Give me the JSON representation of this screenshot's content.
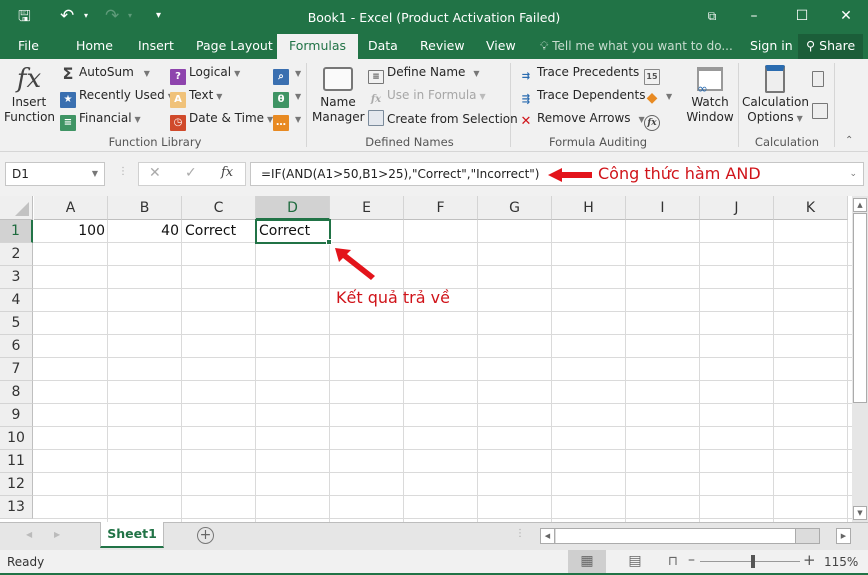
{
  "window": {
    "title": "Book1 - Excel (Product Activation Failed)",
    "controls": {
      "ribbon_display": "⧉",
      "minimize": "–",
      "maximize": "☐",
      "close": "✕"
    }
  },
  "qat": {
    "save": "🖫",
    "undo": "↶",
    "redo": "↷",
    "customize": "▾"
  },
  "tabs": [
    {
      "label": "File"
    },
    {
      "label": "Home"
    },
    {
      "label": "Insert"
    },
    {
      "label": "Page Layout"
    },
    {
      "label": "Formulas",
      "active": true
    },
    {
      "label": "Data"
    },
    {
      "label": "Review"
    },
    {
      "label": "View"
    }
  ],
  "tellme": {
    "placeholder": "Tell me what you want to do..."
  },
  "account": {
    "signin": "Sign in",
    "share": "Share"
  },
  "ribbon": {
    "function_library": {
      "label": "Function Library",
      "insert_function": [
        "Insert",
        "Function"
      ],
      "autosum": "AutoSum",
      "recently_used": "Recently Used",
      "financial": "Financial",
      "logical": "Logical",
      "text": "Text",
      "date_time": "Date & Time"
    },
    "defined_names": {
      "label": "Defined Names",
      "name_manager": [
        "Name",
        "Manager"
      ],
      "define_name": "Define Name",
      "use_in_formula": "Use in Formula",
      "create_from_selection": "Create from Selection"
    },
    "formula_auditing": {
      "label": "Formula Auditing",
      "trace_precedents": "Trace Precedents",
      "trace_dependents": "Trace Dependents",
      "remove_arrows": "Remove Arrows",
      "watch_window": [
        "Watch",
        "Window"
      ]
    },
    "calculation": {
      "label": "Calculation",
      "calc_options": [
        "Calculation",
        "Options"
      ]
    }
  },
  "formula_bar": {
    "name_box": "D1",
    "cancel": "✕",
    "enter": "✓",
    "fx": "fx",
    "formula": "=IF(AND(A1>50,B1>25),\"Correct\",\"Incorrect\")"
  },
  "annotations": {
    "formula_note": "Công thức hàm AND",
    "result_note": "Kết quả trả về",
    "color": "#d0141a"
  },
  "grid": {
    "columns": [
      "A",
      "B",
      "C",
      "D",
      "E",
      "F",
      "G",
      "H",
      "I",
      "J",
      "K"
    ],
    "rows": [
      "1",
      "2",
      "3",
      "4",
      "5",
      "6",
      "7",
      "8",
      "9",
      "10",
      "11",
      "12",
      "13"
    ],
    "selected_cell": "D1",
    "cells": {
      "A1": "100",
      "B1": "40",
      "C1": "Correct",
      "D1": "Correct"
    }
  },
  "sheets": [
    {
      "label": "Sheet1",
      "active": true
    }
  ],
  "status": {
    "ready": "Ready",
    "zoom": "115%"
  },
  "colors": {
    "accent": "#217346"
  }
}
